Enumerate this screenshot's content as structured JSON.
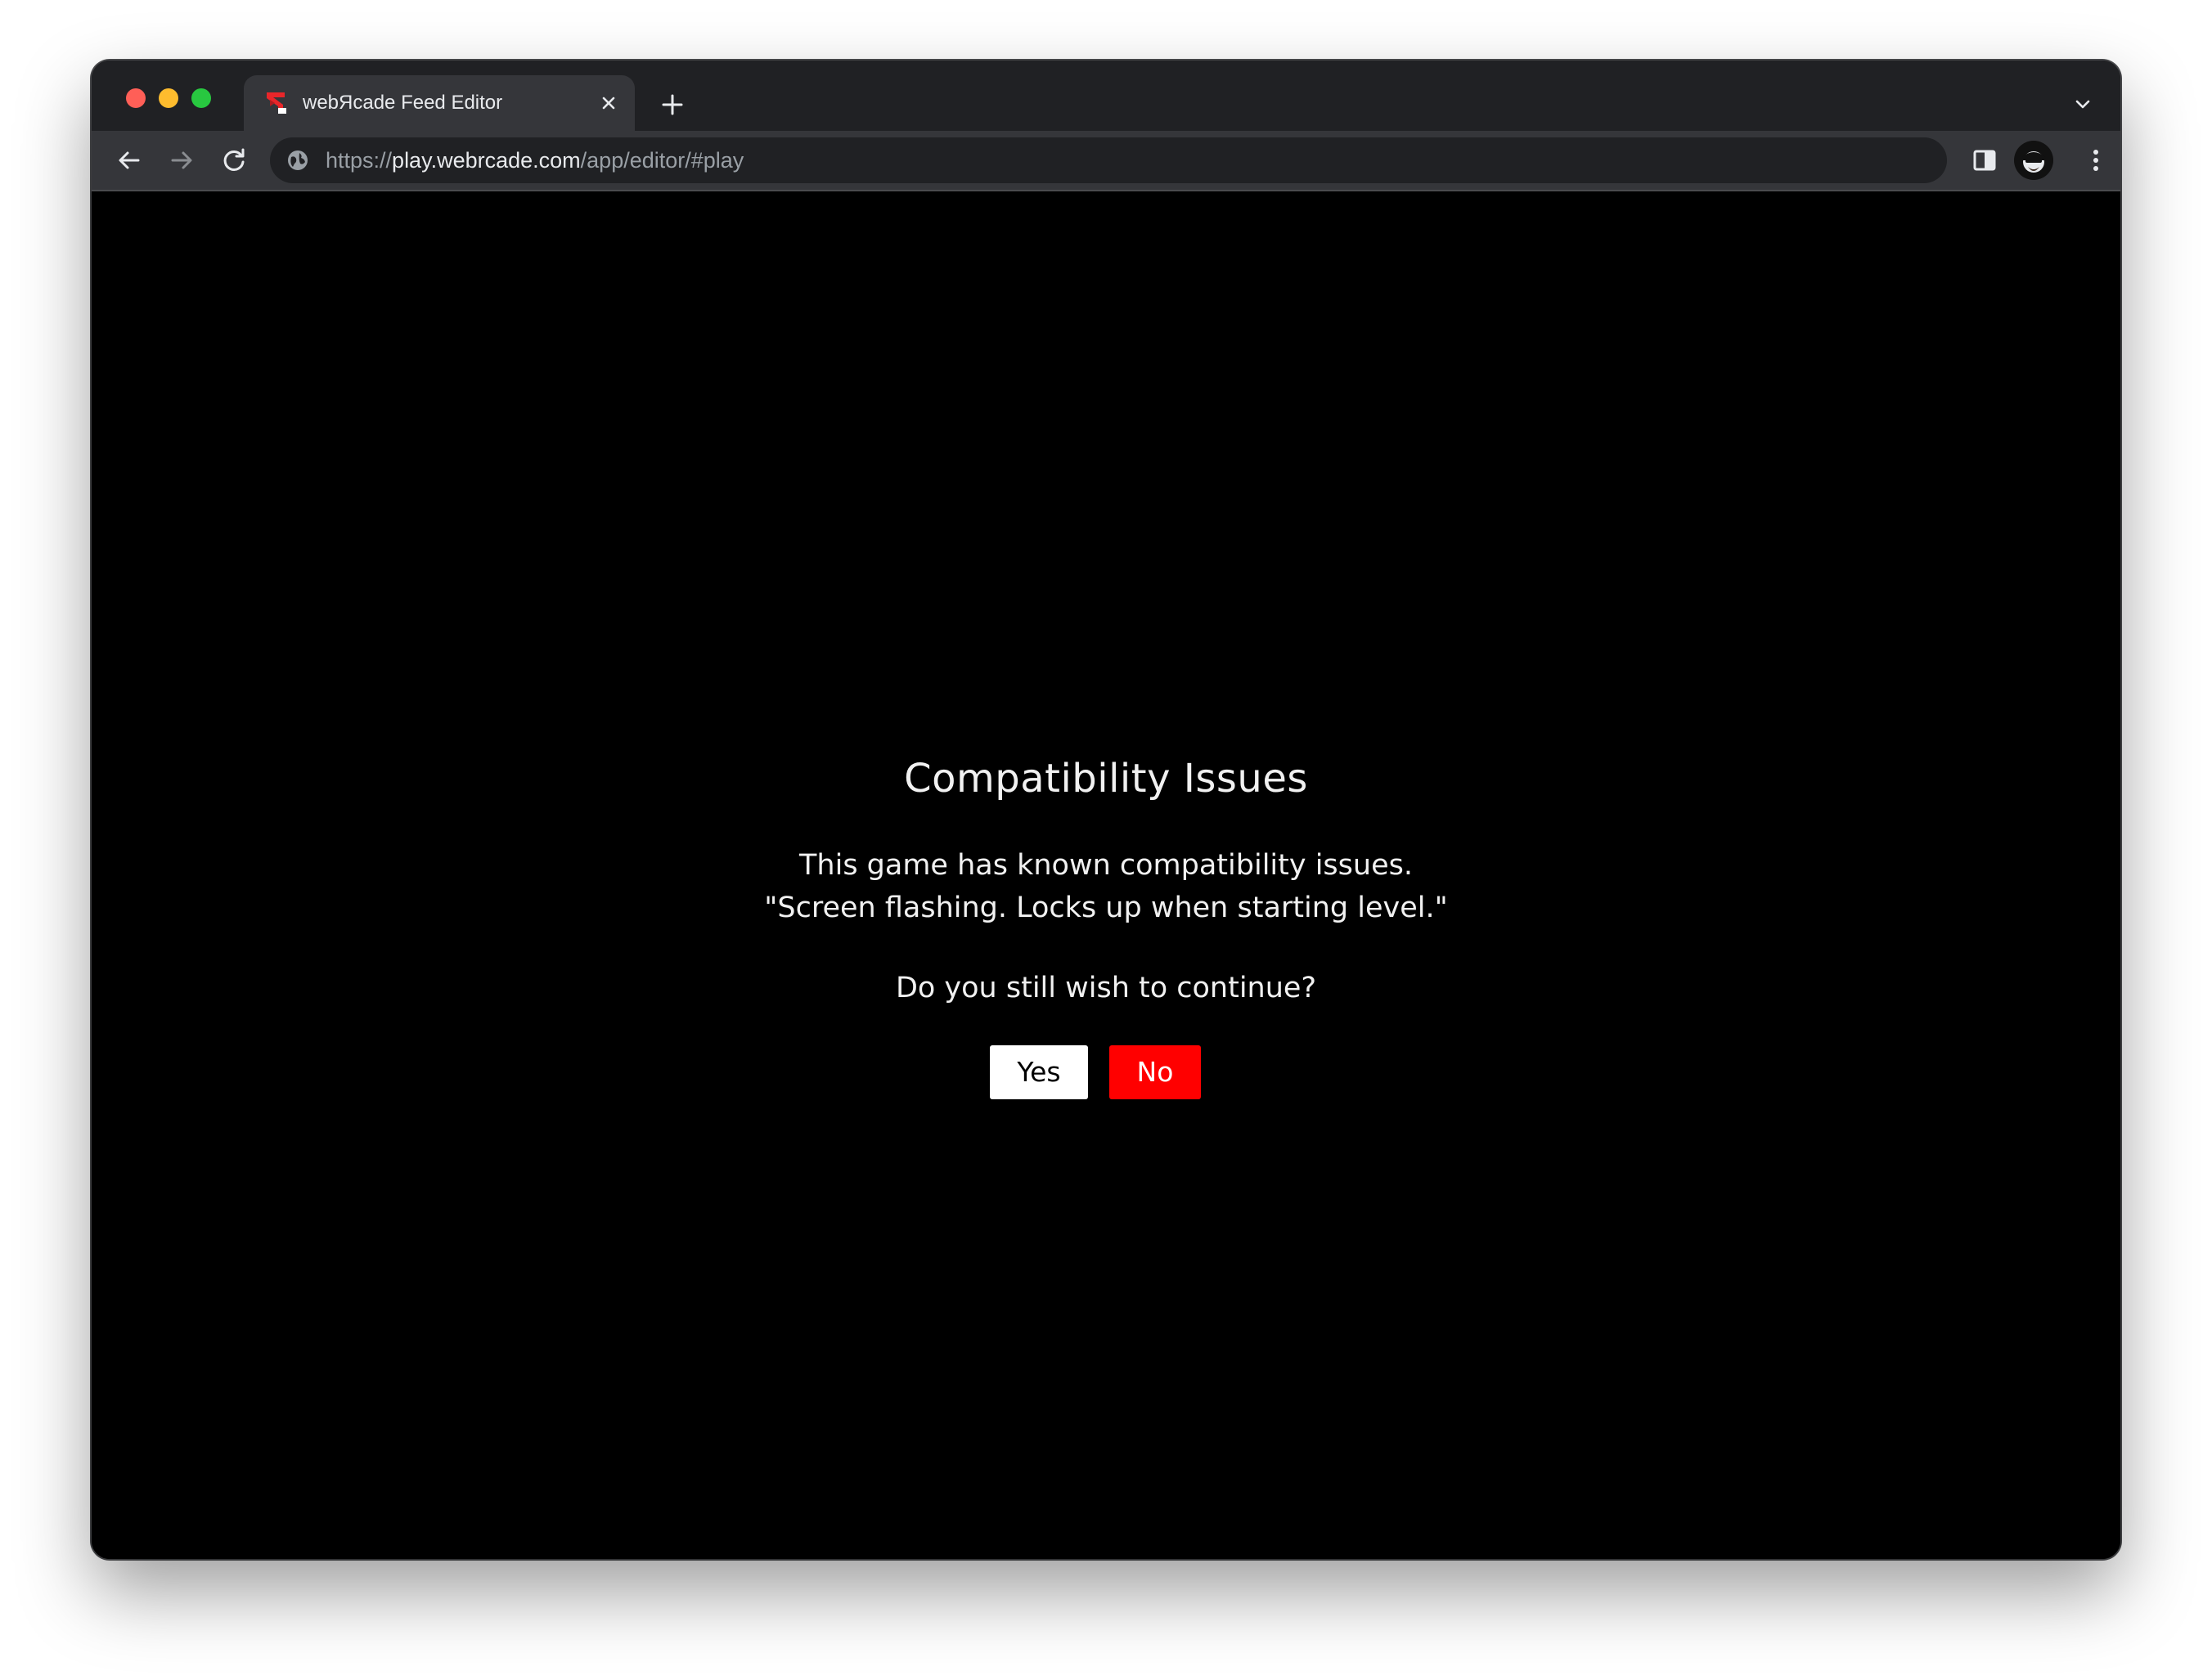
{
  "browser": {
    "tab": {
      "title": "webЯcade Feed Editor"
    },
    "address": {
      "scheme": "https://",
      "host": "play.webrcade.com",
      "path": "/app/editor/#play"
    }
  },
  "dialog": {
    "title": "Compatibility Issues",
    "message_line1": "This game has known compatibility issues.",
    "message_line2": "\"Screen flashing. Locks up when starting level.\"",
    "question": "Do you still wish to continue?",
    "yes_label": "Yes",
    "no_label": "No"
  },
  "colors": {
    "page_background": "#000000",
    "chrome_dark": "#202124",
    "chrome_toolbar": "#35363a",
    "no_button": "#ff0000",
    "yes_button": "#ffffff"
  },
  "icons": {
    "traffic_lights": [
      "close-dot-icon",
      "minimize-dot-icon",
      "zoom-dot-icon"
    ],
    "tab": [
      "webrcade-logo-icon",
      "close-icon"
    ],
    "toolbar": [
      "back-arrow-icon",
      "forward-arrow-icon",
      "reload-icon",
      "site-info-icon",
      "side-panel-icon",
      "profile-avatar-icon",
      "more-vert-icon"
    ],
    "tabstrip": [
      "plus-icon",
      "chevron-down-icon"
    ]
  }
}
